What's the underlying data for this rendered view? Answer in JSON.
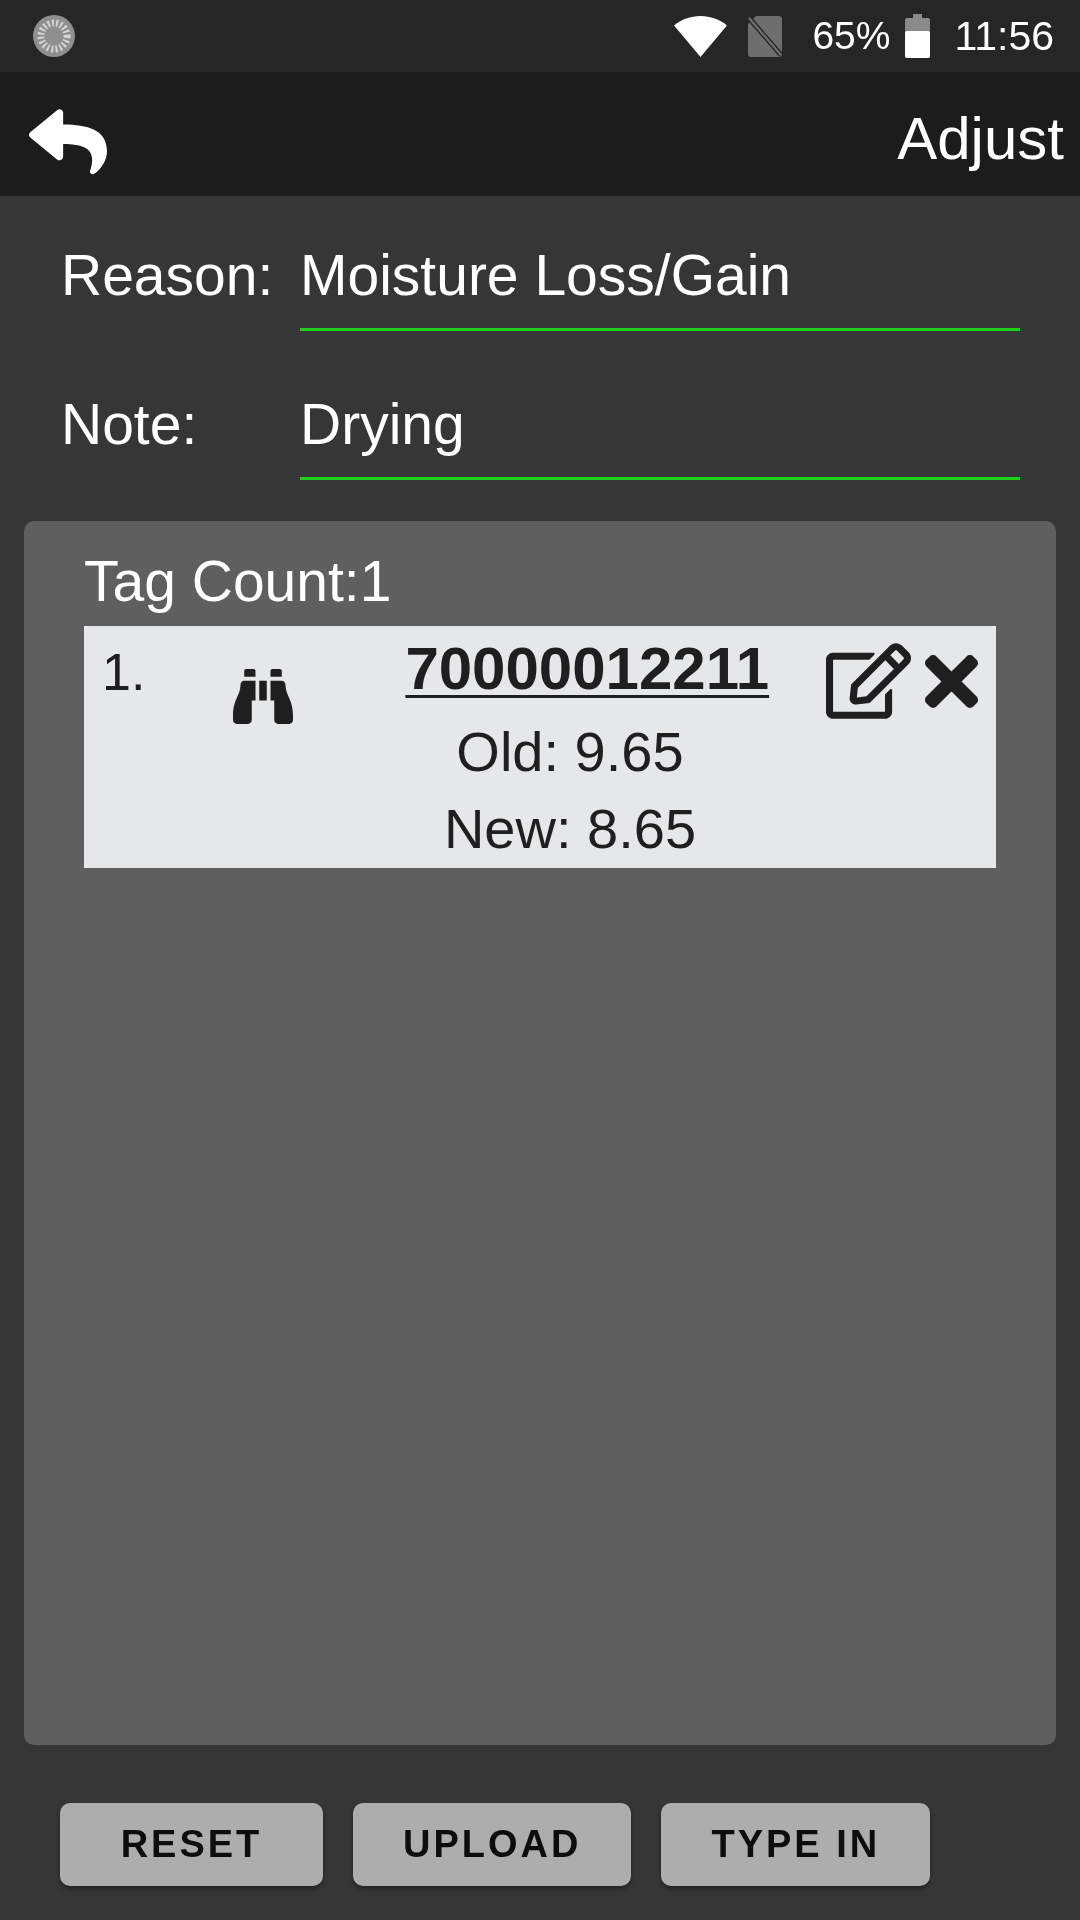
{
  "status_bar": {
    "battery": "65%",
    "time": "11:56"
  },
  "toolbar": {
    "title": "Adjust"
  },
  "form": {
    "fields": [
      {
        "label": "Reason:",
        "value": "Moisture Loss/Gain"
      },
      {
        "label": "Note:",
        "value": "Drying"
      }
    ]
  },
  "tags": {
    "count_label": "Tag Count:1",
    "items": [
      {
        "index": "1.",
        "tag": "70000012211",
        "old": "Old: 9.65",
        "new": "New: 8.65"
      }
    ]
  },
  "buttons": [
    "RESET",
    "UPLOAD",
    "TYPE IN"
  ]
}
